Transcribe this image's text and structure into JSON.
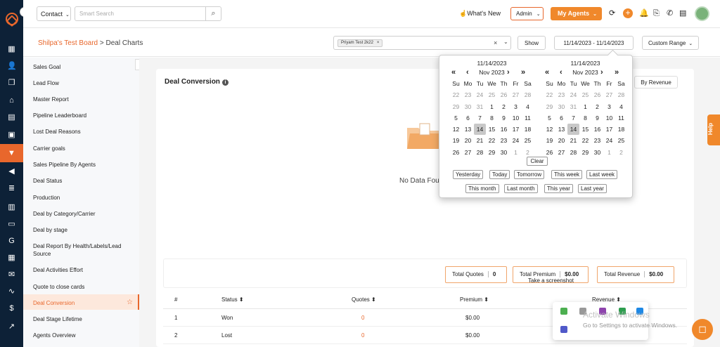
{
  "header": {
    "contact_select": "Contact",
    "search_placeholder": "Smart Search",
    "whats_new": "What's New",
    "admin": "Admin",
    "my_agents": "My Agents"
  },
  "breadcrumb": {
    "board": "Shilpa's Test Board",
    "separator": " > ",
    "page": "Deal Charts"
  },
  "filters": {
    "chip": "Priyam Test 2k22",
    "show": "Show",
    "date_range": "11/14/2023 - 11/14/2023",
    "range_type": "Custom Range"
  },
  "sidebar": {
    "items": [
      {
        "label": "Sales Goal"
      },
      {
        "label": "Lead Flow"
      },
      {
        "label": "Master Report"
      },
      {
        "label": "Pipeline Leaderboard"
      },
      {
        "label": "Lost Deal Reasons"
      },
      {
        "label": "Carrier goals"
      },
      {
        "label": "Sales Pipeline By Agents"
      },
      {
        "label": "Deal Status"
      },
      {
        "label": "Production"
      },
      {
        "label": "Deal by Category/Carrier"
      },
      {
        "label": "Deal by stage"
      },
      {
        "label": "Deal Report By Health/Labels/Lead Source"
      },
      {
        "label": "Deal Activities Effort"
      },
      {
        "label": "Quote to close cards"
      },
      {
        "label": "Deal Conversion"
      },
      {
        "label": "Deal Stage Lifetime"
      },
      {
        "label": "Agents Overview"
      }
    ],
    "active_index": 14
  },
  "card": {
    "title": "Deal Conversion",
    "by_revenue": "By Revenue",
    "no_data": "No Data Fou",
    "summary": {
      "total_quotes_label": "Total Quotes",
      "total_quotes_value": "0",
      "total_premium_label": "Total Premium",
      "total_premium_value": "$0.00",
      "total_revenue_label": "Total Revenue",
      "total_revenue_value": "$0.00"
    },
    "tooltip": "Take a screenshot",
    "table": {
      "headers": [
        "#",
        "Status ⬍",
        "Quotes ⬍",
        "Premium ⬍",
        "Revenue ⬍"
      ],
      "rows": [
        {
          "num": "1",
          "status": "Won",
          "quotes": "0",
          "premium": "$0.00"
        },
        {
          "num": "2",
          "status": "Lost",
          "quotes": "0",
          "premium": "$0.00"
        }
      ]
    }
  },
  "datepicker": {
    "left": {
      "date": "11/14/2023",
      "month": "Nov 2023"
    },
    "right": {
      "date": "11/14/2023",
      "month": "Nov 2023"
    },
    "dow": [
      "Su",
      "Mo",
      "Tu",
      "We",
      "Th",
      "Fr",
      "Sa"
    ],
    "days": [
      "22",
      "23",
      "24",
      "25",
      "26",
      "27",
      "28",
      "29",
      "30",
      "31",
      "1",
      "2",
      "3",
      "4",
      "5",
      "6",
      "7",
      "8",
      "9",
      "10",
      "11",
      "12",
      "13",
      "14",
      "15",
      "16",
      "17",
      "18",
      "19",
      "20",
      "21",
      "22",
      "23",
      "24",
      "25",
      "26",
      "27",
      "28",
      "29",
      "30",
      "1",
      "2"
    ],
    "muted_indices": [
      0,
      1,
      2,
      3,
      4,
      5,
      6,
      7,
      8,
      9,
      40,
      41
    ],
    "selected_index": 23,
    "clear": "Clear",
    "quick": [
      "Yesterday",
      "Today",
      "Tomorrow",
      "This week",
      "Last week",
      "This month",
      "Last month",
      "This year",
      "Last year"
    ]
  },
  "help": "Help",
  "activate": {
    "title": "Activate Windows",
    "subtitle": "Go to Settings to activate Windows."
  },
  "colors": {
    "accent": "#e8672c",
    "brand_orange": "#f0882b",
    "sidebar_dark": "#0d2137"
  }
}
